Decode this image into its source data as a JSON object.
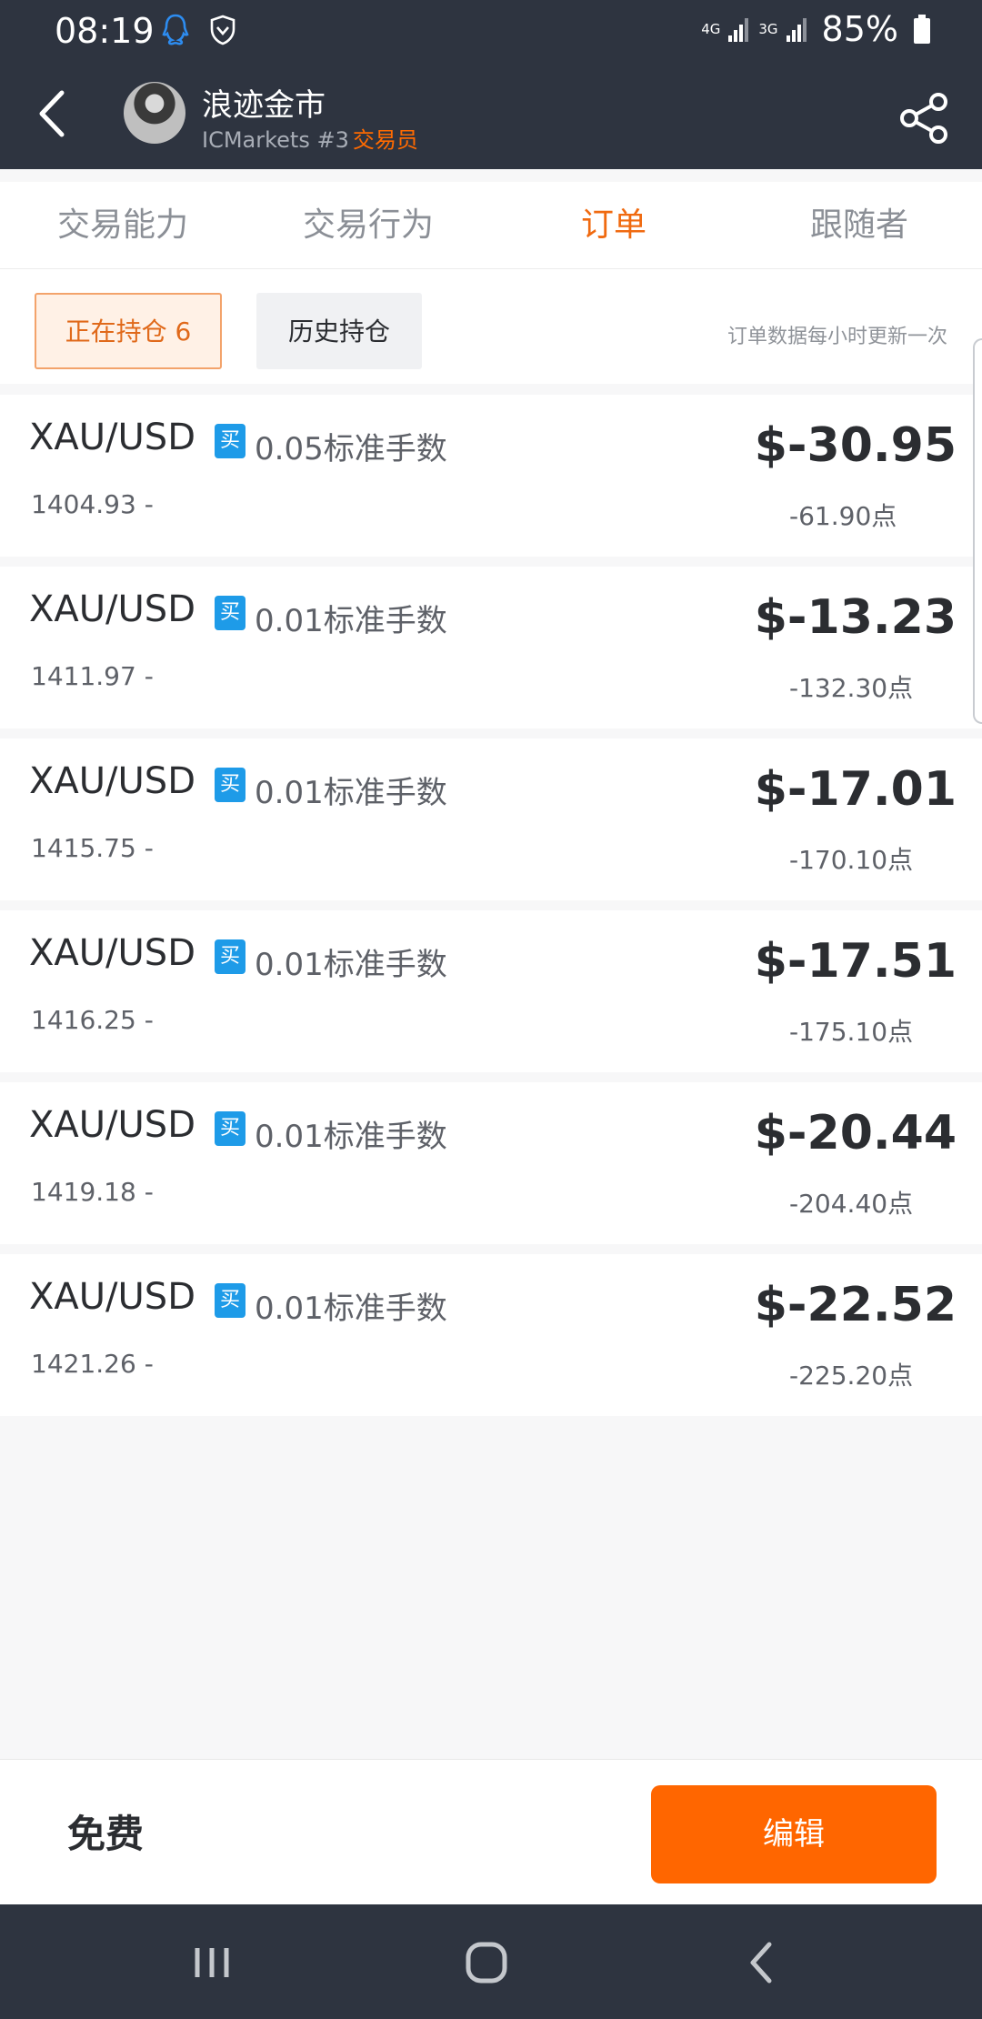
{
  "status_bar": {
    "time": "08:19",
    "net_4g": "4G",
    "net_3g": "3G",
    "battery": "85%"
  },
  "header": {
    "trader_name": "浪迹金市",
    "broker": "ICMarkets #3",
    "role": "交易员"
  },
  "tabs": [
    {
      "label": "交易能力"
    },
    {
      "label": "交易行为"
    },
    {
      "label": "订单"
    },
    {
      "label": "跟随者"
    }
  ],
  "active_tab": "订单",
  "filters": {
    "open_label": "正在持仓 6",
    "history_label": "历史持仓",
    "update_note": "订单数据每小时更新一次"
  },
  "orders": [
    {
      "symbol": "XAU/USD",
      "side": "买",
      "lots": "0.05标准手数",
      "open_price": "1404.93 -",
      "profit": "$-30.95",
      "points": "-61.90点"
    },
    {
      "symbol": "XAU/USD",
      "side": "买",
      "lots": "0.01标准手数",
      "open_price": "1411.97 -",
      "profit": "$-13.23",
      "points": "-132.30点"
    },
    {
      "symbol": "XAU/USD",
      "side": "买",
      "lots": "0.01标准手数",
      "open_price": "1415.75 -",
      "profit": "$-17.01",
      "points": "-170.10点"
    },
    {
      "symbol": "XAU/USD",
      "side": "买",
      "lots": "0.01标准手数",
      "open_price": "1416.25 -",
      "profit": "$-17.51",
      "points": "-175.10点"
    },
    {
      "symbol": "XAU/USD",
      "side": "买",
      "lots": "0.01标准手数",
      "open_price": "1419.18 -",
      "profit": "$-20.44",
      "points": "-204.40点"
    },
    {
      "symbol": "XAU/USD",
      "side": "买",
      "lots": "0.01标准手数",
      "open_price": "1421.26 -",
      "profit": "$-22.52",
      "points": "-225.20点"
    }
  ],
  "footer": {
    "price_label": "免费",
    "edit_label": "编辑"
  },
  "colors": {
    "accent": "#ff6600",
    "header_bg": "#2e3440",
    "buy_badge": "#1e9be8"
  },
  "icons": {
    "back": "chevron-left-icon",
    "share": "share-icon",
    "nav_recents": "recents-icon",
    "nav_home": "home-icon",
    "nav_back": "back-icon"
  }
}
